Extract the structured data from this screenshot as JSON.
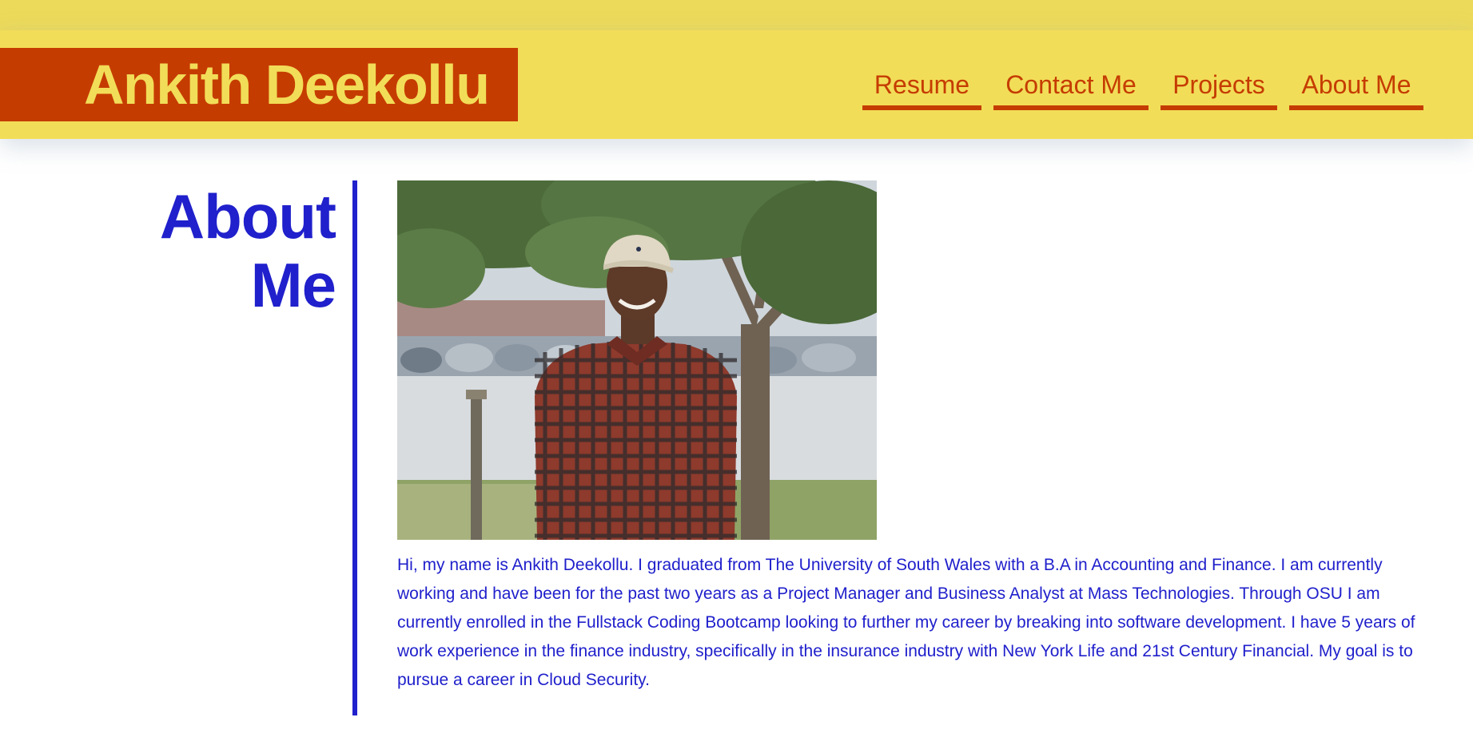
{
  "header": {
    "brand": "Ankith Deekollu",
    "nav": [
      "Resume",
      "Contact Me",
      "Projects",
      "About Me"
    ]
  },
  "about": {
    "title_line1": "About",
    "title_line2": "Me",
    "photo_alt": "Ankith Deekollu",
    "bio": "Hi, my name is Ankith Deekollu. I graduated from The University of South Wales with a B.A in Accounting and Finance. I am currently working and have been for the past two years as a Project Manager and Business Analyst at Mass Technologies. Through OSU I am currently enrolled in the Fullstack Coding Bootcamp looking to further my career by breaking into software development. I have 5 years of work experience in the finance industry, specifically in the insurance industry with New York Life and 21st Century Financial. My goal is to pursue a career in Cloud Security."
  },
  "colors": {
    "header_bg": "#f2dd58",
    "brand_bg": "#c53c00",
    "accent": "#2020cc"
  }
}
